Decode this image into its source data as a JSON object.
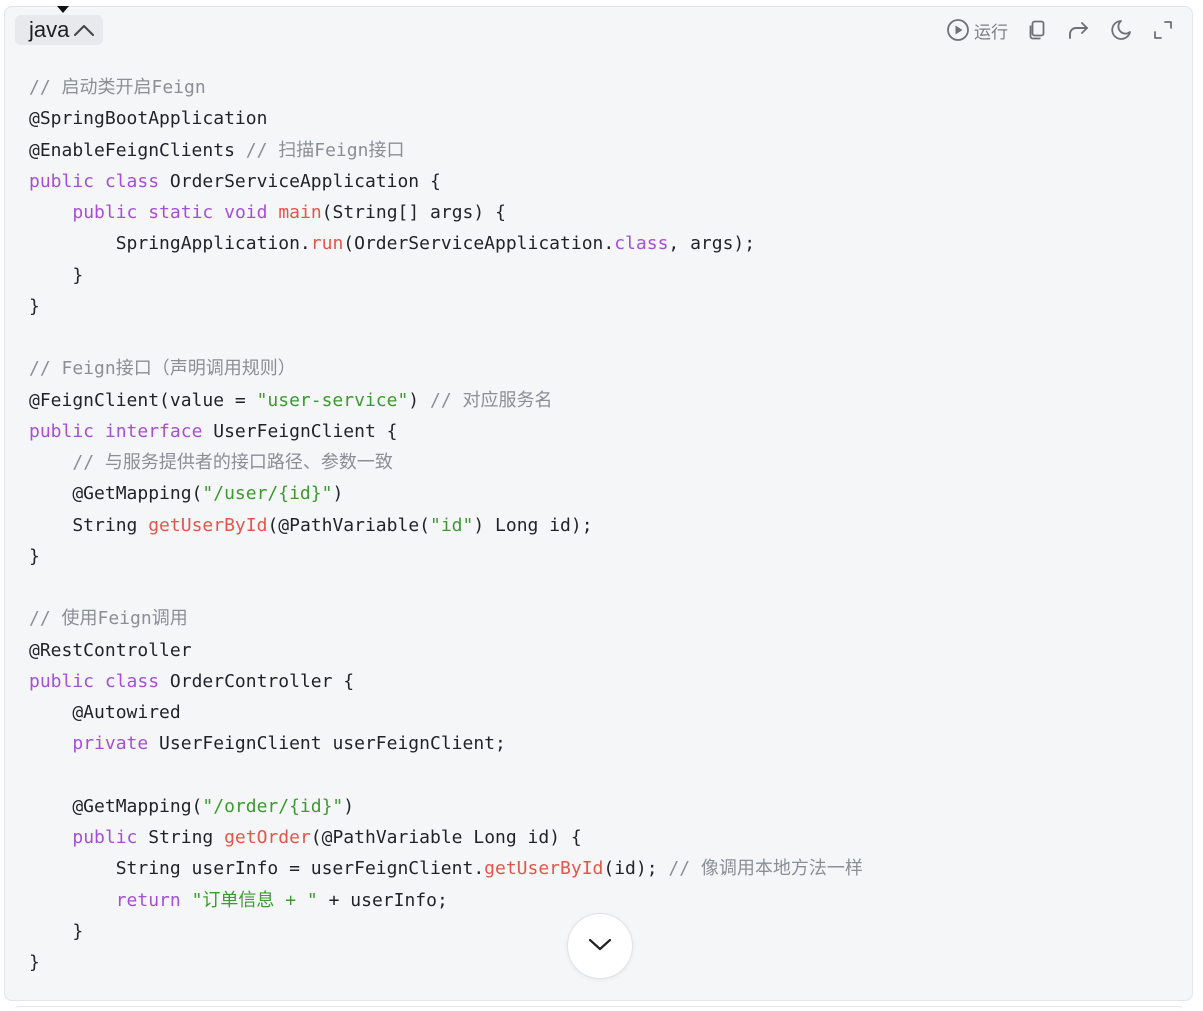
{
  "header": {
    "language": "java",
    "run_label": "运行",
    "icons": [
      "play-circle-icon",
      "copy-icon",
      "share-icon",
      "theme-moon-icon",
      "expand-icon",
      "chevron-up-icon"
    ]
  },
  "code": {
    "lines": [
      [
        {
          "t": "comment",
          "v": "// 启动类开启Feign"
        }
      ],
      [
        {
          "t": "plain",
          "v": "@SpringBootApplication"
        }
      ],
      [
        {
          "t": "plain",
          "v": "@EnableFeignClients "
        },
        {
          "t": "comment",
          "v": "// 扫描Feign接口"
        }
      ],
      [
        {
          "t": "keyword",
          "v": "public"
        },
        {
          "t": "plain",
          "v": " "
        },
        {
          "t": "keyword",
          "v": "class"
        },
        {
          "t": "plain",
          "v": " OrderServiceApplication {"
        }
      ],
      [
        {
          "t": "plain",
          "v": "    "
        },
        {
          "t": "keyword",
          "v": "public"
        },
        {
          "t": "plain",
          "v": " "
        },
        {
          "t": "keyword",
          "v": "static"
        },
        {
          "t": "plain",
          "v": " "
        },
        {
          "t": "keyword",
          "v": "void"
        },
        {
          "t": "plain",
          "v": " "
        },
        {
          "t": "func",
          "v": "main"
        },
        {
          "t": "plain",
          "v": "(String[] args) {"
        }
      ],
      [
        {
          "t": "plain",
          "v": "        SpringApplication."
        },
        {
          "t": "func",
          "v": "run"
        },
        {
          "t": "plain",
          "v": "(OrderServiceApplication."
        },
        {
          "t": "keyword",
          "v": "class"
        },
        {
          "t": "plain",
          "v": ", args);"
        }
      ],
      [
        {
          "t": "plain",
          "v": "    }"
        }
      ],
      [
        {
          "t": "plain",
          "v": "}"
        }
      ],
      [],
      [
        {
          "t": "comment",
          "v": "// Feign接口（声明调用规则）"
        }
      ],
      [
        {
          "t": "plain",
          "v": "@FeignClient(value = "
        },
        {
          "t": "string",
          "v": "\"user-service\""
        },
        {
          "t": "plain",
          "v": ") "
        },
        {
          "t": "comment",
          "v": "// 对应服务名"
        }
      ],
      [
        {
          "t": "keyword",
          "v": "public"
        },
        {
          "t": "plain",
          "v": " "
        },
        {
          "t": "keyword",
          "v": "interface"
        },
        {
          "t": "plain",
          "v": " UserFeignClient {"
        }
      ],
      [
        {
          "t": "plain",
          "v": "    "
        },
        {
          "t": "comment",
          "v": "// 与服务提供者的接口路径、参数一致"
        }
      ],
      [
        {
          "t": "plain",
          "v": "    @GetMapping("
        },
        {
          "t": "string",
          "v": "\"/user/{id}\""
        },
        {
          "t": "plain",
          "v": ")"
        }
      ],
      [
        {
          "t": "plain",
          "v": "    String "
        },
        {
          "t": "func",
          "v": "getUserById"
        },
        {
          "t": "plain",
          "v": "(@PathVariable("
        },
        {
          "t": "string",
          "v": "\"id\""
        },
        {
          "t": "plain",
          "v": ") Long id);"
        }
      ],
      [
        {
          "t": "plain",
          "v": "}"
        }
      ],
      [],
      [
        {
          "t": "comment",
          "v": "// 使用Feign调用"
        }
      ],
      [
        {
          "t": "plain",
          "v": "@RestController"
        }
      ],
      [
        {
          "t": "keyword",
          "v": "public"
        },
        {
          "t": "plain",
          "v": " "
        },
        {
          "t": "keyword",
          "v": "class"
        },
        {
          "t": "plain",
          "v": " OrderController {"
        }
      ],
      [
        {
          "t": "plain",
          "v": "    @Autowired"
        }
      ],
      [
        {
          "t": "plain",
          "v": "    "
        },
        {
          "t": "keyword",
          "v": "private"
        },
        {
          "t": "plain",
          "v": " UserFeignClient userFeignClient;"
        }
      ],
      [],
      [
        {
          "t": "plain",
          "v": "    @GetMapping("
        },
        {
          "t": "string",
          "v": "\"/order/{id}\""
        },
        {
          "t": "plain",
          "v": ")"
        }
      ],
      [
        {
          "t": "plain",
          "v": "    "
        },
        {
          "t": "keyword",
          "v": "public"
        },
        {
          "t": "plain",
          "v": " String "
        },
        {
          "t": "func",
          "v": "getOrder"
        },
        {
          "t": "plain",
          "v": "(@PathVariable Long id) {"
        }
      ],
      [
        {
          "t": "plain",
          "v": "        String userInfo = userFeignClient."
        },
        {
          "t": "func",
          "v": "getUserById"
        },
        {
          "t": "plain",
          "v": "(id); "
        },
        {
          "t": "comment",
          "v": "// 像调用本地方法一样"
        }
      ],
      [
        {
          "t": "plain",
          "v": "        "
        },
        {
          "t": "keyword",
          "v": "return"
        },
        {
          "t": "plain",
          "v": " "
        },
        {
          "t": "string",
          "v": "\"订单信息 + \""
        },
        {
          "t": "plain",
          "v": " + userInfo;"
        }
      ],
      [
        {
          "t": "plain",
          "v": "    }"
        }
      ],
      [
        {
          "t": "plain",
          "v": "}"
        }
      ]
    ]
  },
  "scroll_button": {
    "icon": "chevron-down-icon"
  },
  "colors": {
    "comment": "#8a8f96",
    "keyword": "#a64fd6",
    "function": "#e45649",
    "string": "#3c9a2f",
    "text": "#1f2328",
    "background": "#f5f6f8"
  }
}
